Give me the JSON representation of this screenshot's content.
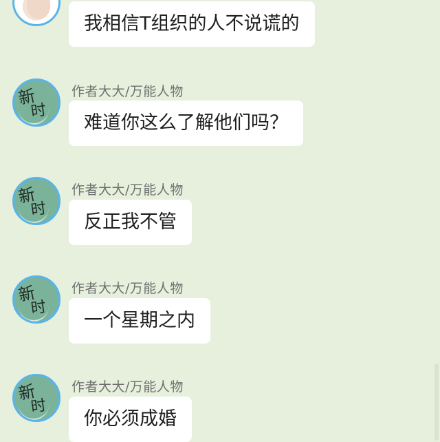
{
  "conversation": {
    "messages": [
      {
        "avatar": "photo-avatar",
        "sender": "",
        "text": "我相信T组织的人不说谎的"
      },
      {
        "avatar": "author-avatar",
        "sender": "作者大大/万能人物",
        "text": "难道你这么了解他们吗？"
      },
      {
        "avatar": "author-avatar",
        "sender": "作者大大/万能人物",
        "text": "反正我不管"
      },
      {
        "avatar": "author-avatar",
        "sender": "作者大大/万能人物",
        "text": "一个星期之内"
      },
      {
        "avatar": "author-avatar",
        "sender": "作者大大/万能人物",
        "text": "你必须成婚"
      }
    ]
  },
  "avatar_logo": {
    "char1": "新",
    "char2": "时"
  },
  "colors": {
    "background": "#e6f0dc",
    "bubble": "#ffffff",
    "avatar_ring": "#58b4ea",
    "avatar_fill": "#7bb39a",
    "sender_text": "#6f6f6f"
  }
}
